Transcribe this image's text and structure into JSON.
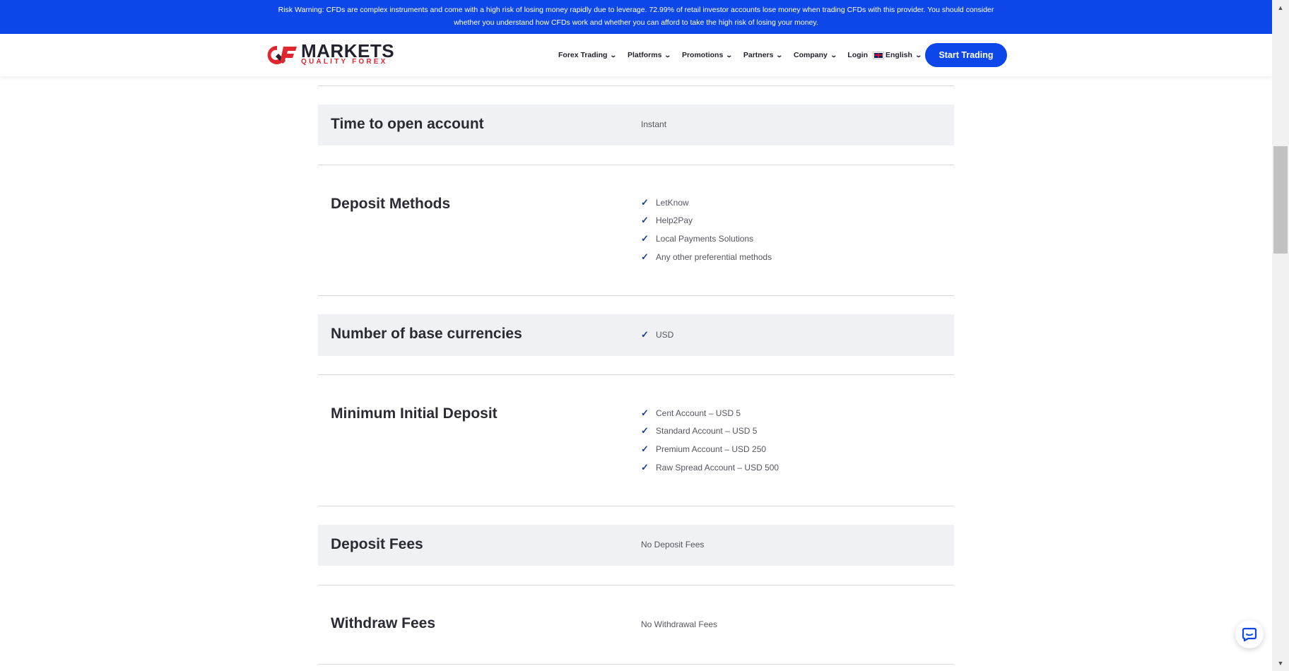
{
  "risk_warning": {
    "line1": "Risk Warning: CFDs are complex instruments and come with a high risk of losing money rapidly due to leverage. 72.99% of retail investor accounts lose money when trading CFDs with this provider. You should consider",
    "line2": "whether you understand how CFDs work and whether you can afford to take the high risk of losing your money."
  },
  "brand": {
    "name": "MARKETS",
    "tagline": "QUALITY FOREX",
    "accent": "#0d47e9",
    "logo_red": "#e0262f"
  },
  "nav": {
    "items": [
      "Forex Trading",
      "Platforms",
      "Promotions",
      "Partners",
      "Company"
    ],
    "login": "Login",
    "language": "English",
    "cta": "Start Trading"
  },
  "rows": [
    {
      "title": "Time to open account",
      "value": "Instant"
    },
    {
      "title": "Deposit Methods",
      "list": [
        "LetKnow",
        "Help2Pay",
        "Local Payments Solutions",
        "Any other preferential methods"
      ]
    },
    {
      "title": "Number of base currencies",
      "list": [
        "USD"
      ]
    },
    {
      "title": "Minimum Initial Deposit",
      "list": [
        "Cent Account – USD 5",
        "Standard Account – USD 5",
        "Premium Account – USD 250",
        "Raw Spread Account – USD 500"
      ]
    },
    {
      "title": "Deposit Fees",
      "value": "No Deposit Fees"
    },
    {
      "title": "Withdraw Fees",
      "value": "No Withdrawal Fees"
    }
  ],
  "icons": {
    "check": "check-icon",
    "chat": "chat-icon",
    "chevron": "chevron-down-icon"
  }
}
